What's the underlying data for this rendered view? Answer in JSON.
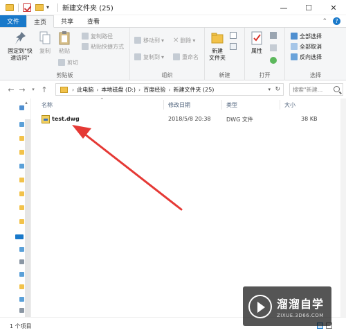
{
  "window": {
    "title": "新建文件夹 (25)",
    "controls": [
      "—",
      "☐",
      "✕"
    ]
  },
  "ribbon_tabs": {
    "file": "文件",
    "home": "主页",
    "share": "共享",
    "view": "查看"
  },
  "ribbon": {
    "clipboard": {
      "label": "剪贴板",
      "pin": "固定到\"快速访问\"",
      "copy": "复制",
      "paste": "粘贴",
      "copy_path": "复制路径",
      "paste_shortcut": "粘贴快捷方式",
      "cut": "剪切"
    },
    "organize": {
      "label": "组织",
      "move_to": "移动到",
      "copy_to": "复制到",
      "delete": "删除",
      "rename": "重命名"
    },
    "new": {
      "label": "新建",
      "new_folder": "新建\n文件夹"
    },
    "open": {
      "label": "打开",
      "properties": "属性"
    },
    "select": {
      "label": "选择",
      "select_all": "全部选择",
      "select_none": "全部取消",
      "invert": "反向选择"
    }
  },
  "address": {
    "crumbs": [
      "此电脑",
      "本地磁盘 (D:)",
      "百度经验",
      "新建文件夹 (25)"
    ],
    "search_placeholder": "搜索\"新建..."
  },
  "columns": {
    "name": "名称",
    "modified": "修改日期",
    "type": "类型",
    "size": "大小"
  },
  "files": [
    {
      "name": "test.dwg",
      "modified": "2018/5/8 20:38",
      "type": "DWG 文件",
      "size": "38 KB"
    }
  ],
  "status": {
    "count": "1 个项目"
  },
  "watermark": {
    "main": "溜溜自学",
    "sub": "ZIXUE.3D66.COM"
  },
  "colors": {
    "file_tab": "#1979ca",
    "annotation_arrow": "#e53935",
    "ribbon_bg": "#f5f6f7"
  }
}
